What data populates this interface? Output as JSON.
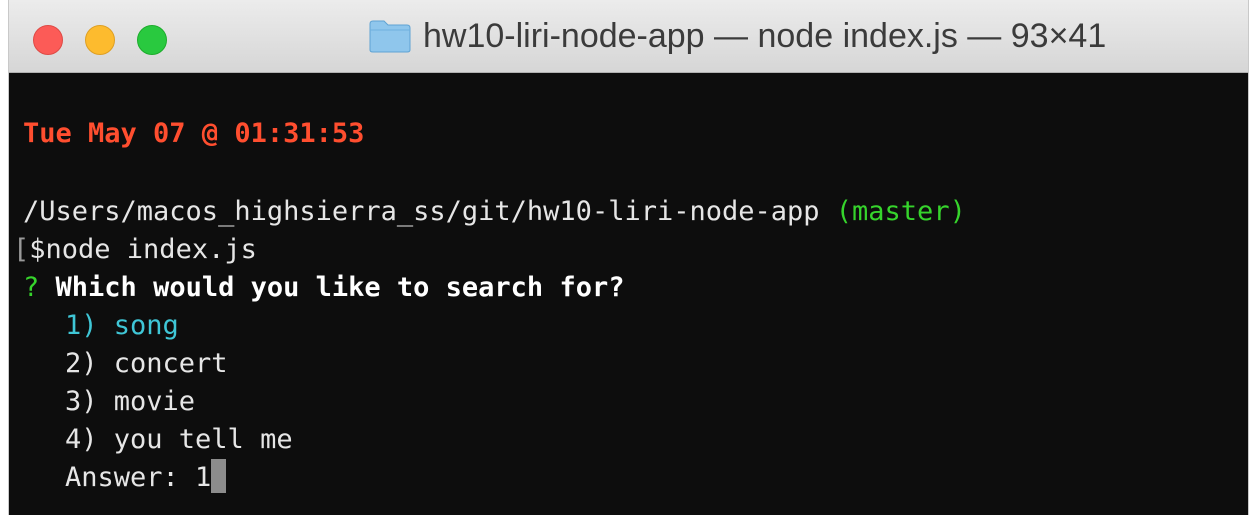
{
  "window": {
    "title": "hw10-liri-node-app — node index.js — 93×41",
    "icon": "folder-icon",
    "buttons": [
      "close",
      "minimize",
      "maximize"
    ]
  },
  "terminal": {
    "date_line": "Tue May 07 @ 01:31:53",
    "path": "/Users/macos_highsierra_ss/git/hw10-liri-node-app",
    "branch": "(master)",
    "prompt_bracket": "[",
    "command": "$node index.js",
    "question_mark": "?",
    "question": "Which would you like to search for?",
    "options": [
      "1) song",
      "2) concert",
      "3) movie",
      "4) you tell me"
    ],
    "answer_label": "Answer: 1"
  },
  "colors": {
    "date": "#ff4e2f",
    "branch": "#36d42c",
    "selected_option": "#3fc6d6",
    "background": "#0d0d0d"
  }
}
